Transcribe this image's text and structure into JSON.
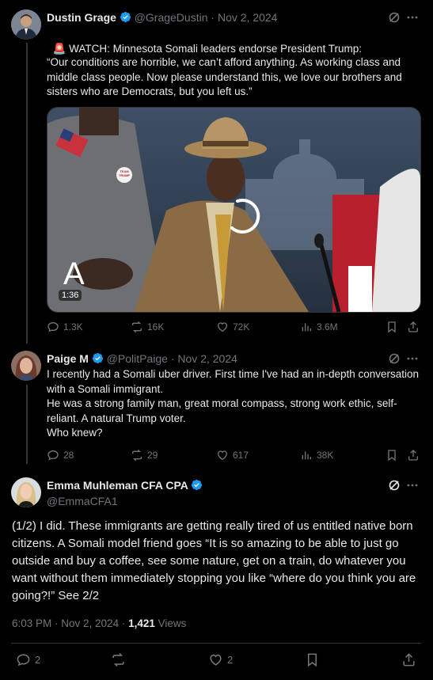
{
  "tweet1": {
    "name": "Dustin Grage",
    "handle": "@GrageDustin",
    "date": "Nov 2, 2024",
    "emoji": "🚨",
    "text_line1": " WATCH: Minnesota Somali leaders endorse President Trump:",
    "quote": "“Our conditions are horrible, we can’t afford anything. As working class and middle class people. Now please understand this, we love our brothers and sisters who are Democrats, but you left us.”",
    "video": {
      "duration": "1:36",
      "overlay_letter": "A",
      "sign_text": "TEAM TRUMP"
    },
    "stats": {
      "replies": "1.3K",
      "reposts": "16K",
      "likes": "72K",
      "views": "3.6M"
    }
  },
  "tweet2": {
    "name": "Paige M",
    "handle": "@PolitPaige",
    "date": "Nov 2, 2024",
    "text": "I recently had a Somali uber driver. First time I've had an in-depth conversation with a Somali immigrant.\nHe was a strong family man, great moral compass, strong work ethic, self-reliant. A natural Trump voter.\nWho knew?",
    "stats": {
      "replies": "28",
      "reposts": "29",
      "likes": "617",
      "views": "38K"
    }
  },
  "tweet3": {
    "name": "Emma Muhleman CFA CPA",
    "handle": "@EmmaCFA1",
    "text": "(1/2) I did. These immigrants are getting really tired of us entitled native born citizens. A Somali model friend goes “It is so amazing to be able to just go outside and buy a coffee, see some nature, get on a train, do whatever you want without them immediately stopping you like “where do you think you are going?!” See 2/2",
    "time": "6:03 PM · Nov 2, 2024 · ",
    "views_count": "1,421",
    "views_label": " Views",
    "stats": {
      "replies": "2",
      "likes": "2"
    }
  },
  "colors": {
    "background": "#000000",
    "text": "#e7e9ea",
    "muted": "#71767b",
    "verified": "#1d9bf0",
    "divider": "#2f3336"
  },
  "icons": [
    "grok-icon",
    "more-icon",
    "reply-icon",
    "repost-icon",
    "like-icon",
    "views-icon",
    "bookmark-icon",
    "share-icon",
    "verified-icon"
  ]
}
